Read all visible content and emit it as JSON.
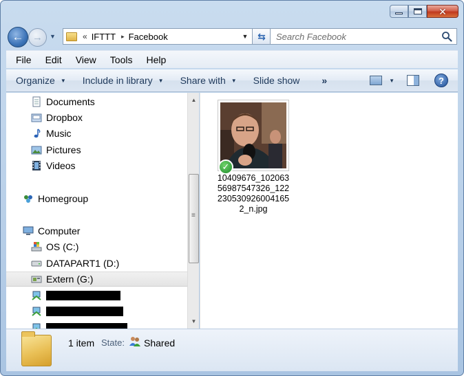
{
  "window": {
    "caption": {
      "minimize": "minimize",
      "maximize": "maximize",
      "close": "close"
    }
  },
  "nav": {
    "breadcrumb_prefix": "«",
    "breadcrumb": [
      "IFTTT",
      "Facebook"
    ],
    "breadcrumb_sep": "▸",
    "search_placeholder": "Search Facebook"
  },
  "menu": [
    "File",
    "Edit",
    "View",
    "Tools",
    "Help"
  ],
  "commands": {
    "organize": "Organize",
    "include": "Include in library",
    "share": "Share with",
    "slideshow": "Slide show",
    "more": "»"
  },
  "navpane": {
    "library_items": [
      {
        "label": "Documents",
        "icon": "documents-icon"
      },
      {
        "label": "Dropbox",
        "icon": "dropbox-icon"
      },
      {
        "label": "Music",
        "icon": "music-icon"
      },
      {
        "label": "Pictures",
        "icon": "pictures-icon"
      },
      {
        "label": "Videos",
        "icon": "videos-icon"
      }
    ],
    "homegroup": "Homegroup",
    "computer": "Computer",
    "drives": [
      {
        "label": "OS (C:)"
      },
      {
        "label": "DATAPART1 (D:)"
      },
      {
        "label": "Extern (G:)",
        "selected": true
      }
    ]
  },
  "content": {
    "file_name": "10409676_10206356987547326_1223053092600416 5 2_n.jpg",
    "file_name_lines": [
      "10409676_102063",
      "56987547326_122",
      "230530926004165",
      "2_n.jpg"
    ],
    "sync_status": "synced"
  },
  "details": {
    "count": "1 item",
    "state_label": "State:",
    "state_value": "Shared"
  },
  "colors": {
    "accent": "#1e395b",
    "sync_green": "#1f8b2c"
  }
}
